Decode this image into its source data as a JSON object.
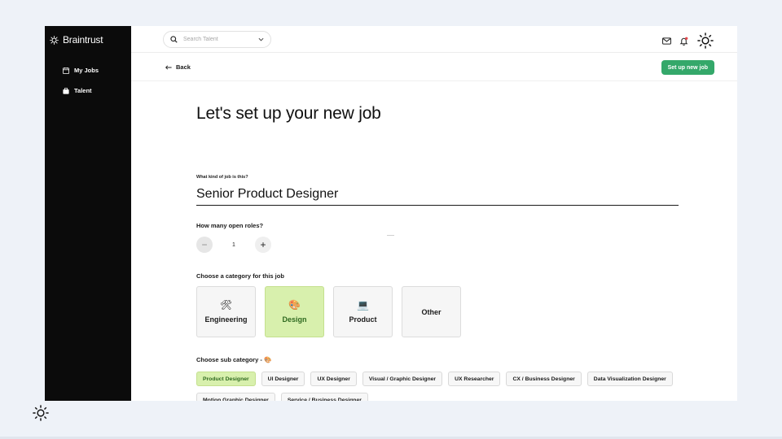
{
  "sidebar": {
    "brand": "Braintrust",
    "items": [
      {
        "label": "My Jobs",
        "icon": "calendar-icon"
      },
      {
        "label": "Talent",
        "icon": "briefcase-icon"
      }
    ]
  },
  "topbar": {
    "search_placeholder": "Search Talent",
    "icons": [
      "mail-icon",
      "bell-icon",
      "gear-icon"
    ]
  },
  "subbar": {
    "back_label": "Back",
    "setup_button": "Set up new job"
  },
  "main": {
    "title": "Let's set up your new job",
    "job_type_label": "What kind of job is this?",
    "job_title_value": "Senior Product Designer",
    "open_roles_label": "How many open roles?",
    "open_roles_value": "1",
    "category_label": "Choose a category for this job",
    "categories": [
      {
        "name": "Engineering",
        "icon": "🛠",
        "selected": false
      },
      {
        "name": "Design",
        "icon": "🎨",
        "selected": true
      },
      {
        "name": "Product",
        "icon": "💻",
        "selected": false
      },
      {
        "name": "Other",
        "icon": "",
        "selected": false
      }
    ],
    "subcategory_label": "Choose sub category",
    "subcategory_icon": "🎨",
    "subcategories": [
      {
        "name": "Product Designer",
        "selected": true
      },
      {
        "name": "UI Designer",
        "selected": false
      },
      {
        "name": "UX Designer",
        "selected": false
      },
      {
        "name": "Visual / Graphic Designer",
        "selected": false
      },
      {
        "name": "UX Researcher",
        "selected": false
      },
      {
        "name": "CX / Business Designer",
        "selected": false
      },
      {
        "name": "Data Visualization Designer",
        "selected": false
      },
      {
        "name": "Motion Graphic Designer",
        "selected": false
      },
      {
        "name": "Service / Business Designer",
        "selected": false
      }
    ]
  },
  "colors": {
    "primary_button": "#34a86a",
    "selected_bg": "#d8f0ad",
    "sidebar_bg": "#0b0b0b"
  }
}
